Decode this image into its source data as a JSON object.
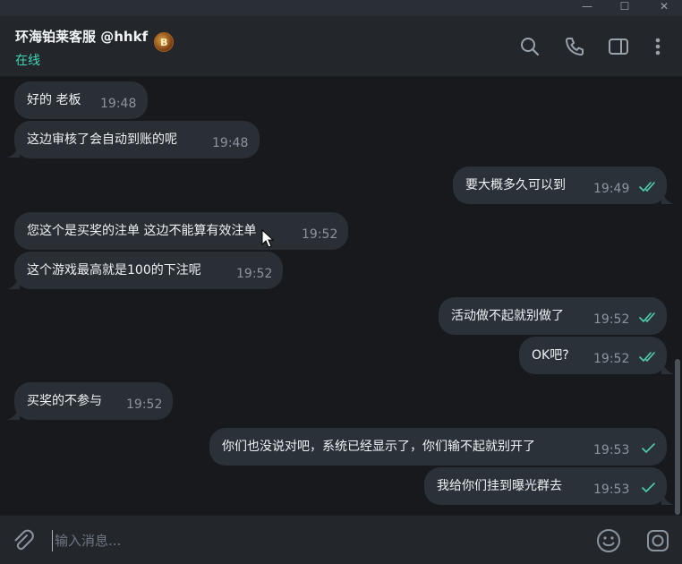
{
  "window": {
    "minimize_glyph": "—",
    "maximize_glyph": "☐",
    "close_glyph": "✕"
  },
  "header": {
    "name": "环海铂莱客服",
    "handle": "@hhkf",
    "badge_letter": "B",
    "status": "在线",
    "accent": "#3fd7b4",
    "icons": [
      "search-icon",
      "phone-icon",
      "sidebar-toggle-icon",
      "more-vertical-icon"
    ]
  },
  "messages": [
    {
      "direction": "in",
      "text": "好的 老板",
      "time": "19:48"
    },
    {
      "direction": "in",
      "text": "这边审核了会自动到账的呢",
      "time": "19:48"
    },
    {
      "direction": "out",
      "text": "要大概多久可以到",
      "time": "19:49",
      "status": "read"
    },
    {
      "direction": "in",
      "text": "您这个是买奖的注单 这边不能算有效注单",
      "time": "19:52"
    },
    {
      "direction": "in",
      "text": "这个游戏最高就是100的下注呢",
      "time": "19:52"
    },
    {
      "direction": "out",
      "text": "活动做不起就别做了",
      "time": "19:52",
      "status": "read"
    },
    {
      "direction": "out",
      "text": "OK吧?",
      "time": "19:52",
      "status": "read"
    },
    {
      "direction": "in",
      "text": "买奖的不参与",
      "time": "19:52"
    },
    {
      "direction": "out",
      "text": "你们也没说对吧，系统已经显示了，你们输不起就别开了",
      "time": "19:53",
      "status": "sent"
    },
    {
      "direction": "out",
      "text": "我给你们挂到曝光群去",
      "time": "19:53",
      "status": "sent"
    }
  ],
  "composer": {
    "placeholder": "输入消息...",
    "icons": [
      "attach-icon",
      "emoji-icon",
      "camera-icon"
    ]
  }
}
